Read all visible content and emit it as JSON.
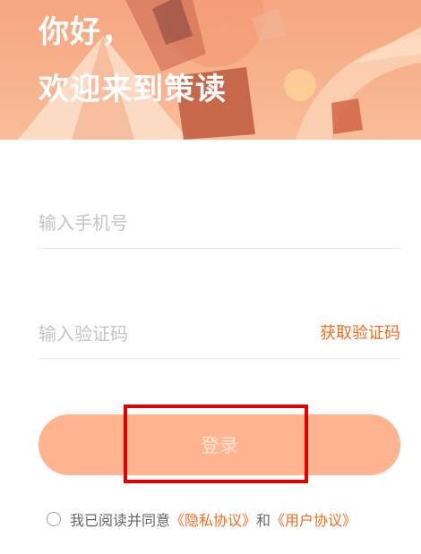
{
  "header": {
    "greeting_line1": "你好，",
    "greeting_line2": "欢迎来到策读"
  },
  "phone": {
    "placeholder": "输入手机号"
  },
  "code": {
    "placeholder": "输入验证码",
    "get_code_label": "获取验证码"
  },
  "login": {
    "label": "登录"
  },
  "agreement": {
    "prefix": "我已阅读并同意",
    "privacy_link": "《隐私协议》",
    "conjunction": "和",
    "user_link": "《用户协议》"
  },
  "colors": {
    "accent": "#ef6c1f",
    "button_bg": "#ffb38f",
    "highlight_box": "#e10000"
  }
}
